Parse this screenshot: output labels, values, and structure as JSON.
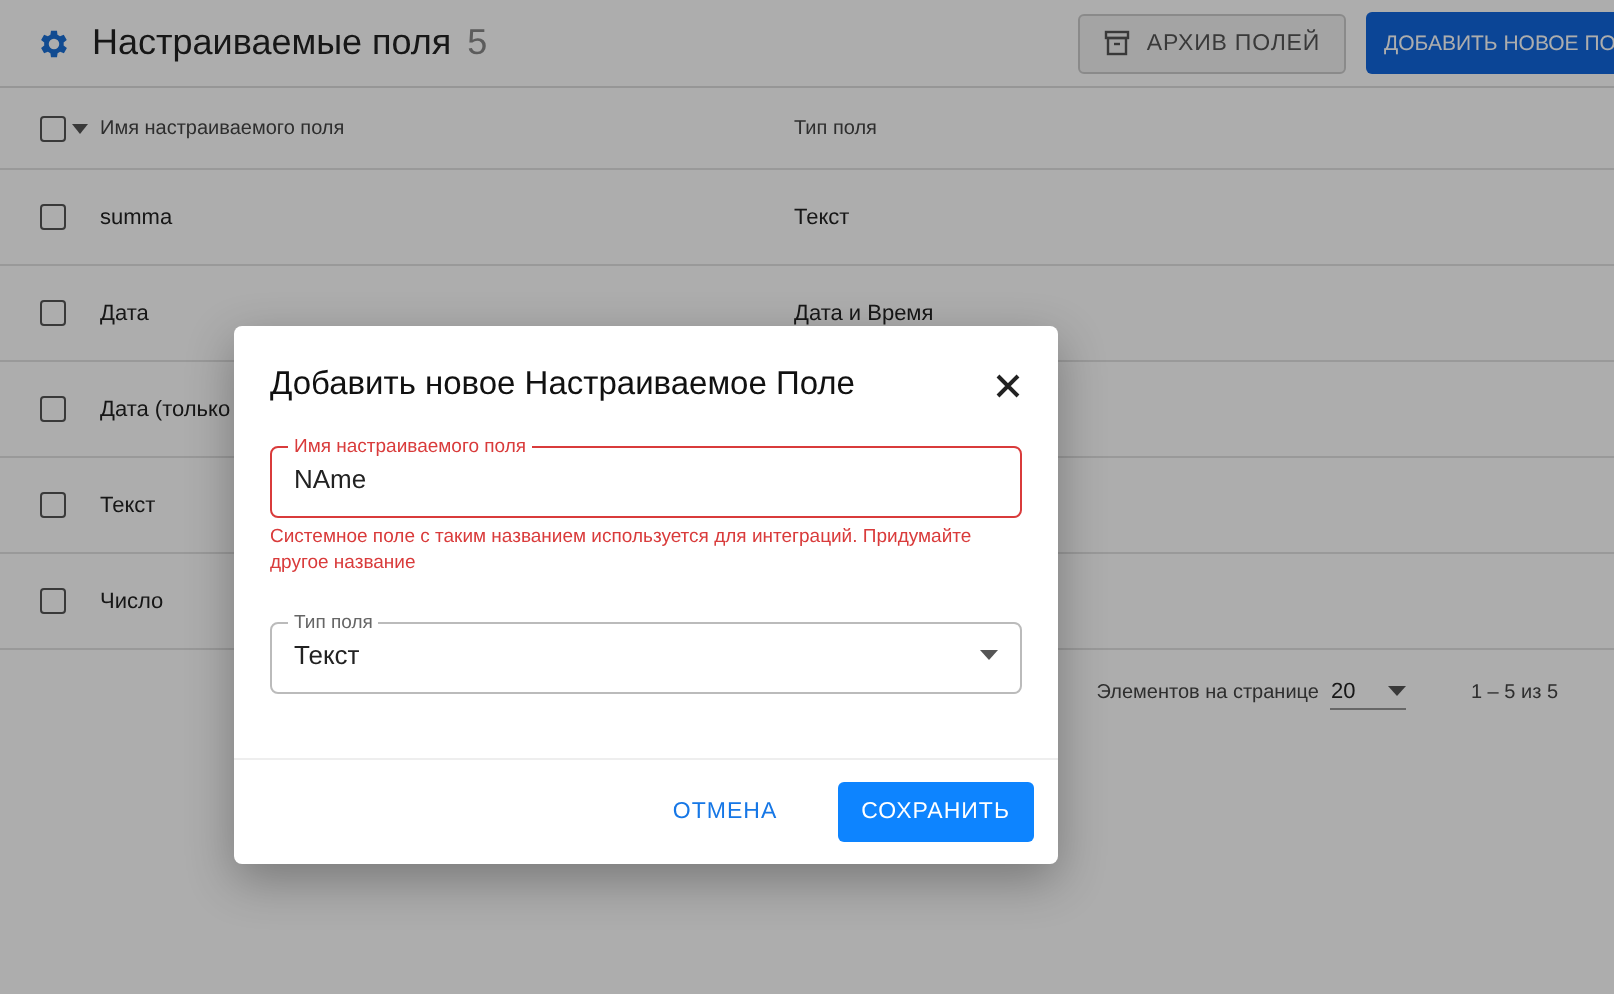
{
  "page": {
    "title": "Настраиваемые поля",
    "count": "5",
    "archive_button": "АРХИВ ПОЛЕЙ",
    "add_button": "ДОБАВИТЬ НОВОЕ ПО"
  },
  "table": {
    "select_all": {
      "checked": false
    },
    "columns": [
      "Имя настраиваемого поля",
      "Тип поля"
    ],
    "rows": [
      {
        "name": "summa",
        "type": "Текст",
        "checked": false
      },
      {
        "name": "Дата",
        "type": "Дата и Время",
        "checked": false
      },
      {
        "name": "Дата (только",
        "checked": false
      },
      {
        "name": "Текст",
        "checked": false
      },
      {
        "name": "Число",
        "checked": false
      }
    ]
  },
  "pagination": {
    "label": "Элементов на странице",
    "per_page": "20",
    "range": "1 – 5 из 5"
  },
  "dialog": {
    "title": "Добавить новое Настраиваемое Поле",
    "name_field": {
      "label": "Имя настраиваемого поля",
      "value": "NAme",
      "error": "Системное поле с таким названием используется для интеграций. Придумайте другое название"
    },
    "type_field": {
      "label": "Тип поля",
      "value": "Текст"
    },
    "buttons": [
      {
        "label": "ОТМЕНА",
        "kind": "text"
      },
      {
        "label": "СОХРАНИТЬ",
        "kind": "primary"
      }
    ]
  }
}
